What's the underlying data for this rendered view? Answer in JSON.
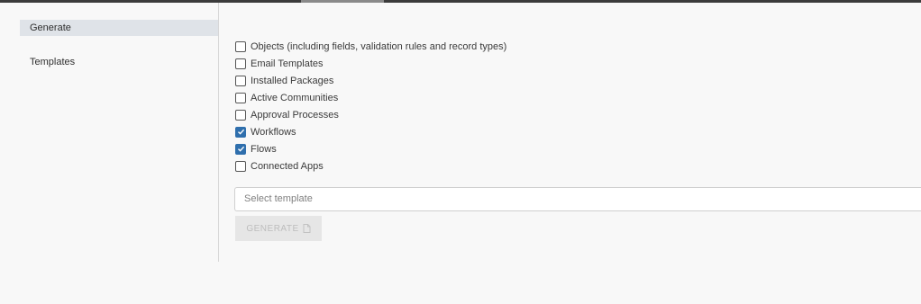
{
  "sidebar": {
    "items": [
      {
        "label": "Generate",
        "active": true
      },
      {
        "label": "Templates",
        "active": false
      }
    ]
  },
  "options": [
    {
      "label": "Objects (including fields, validation rules and record types)",
      "checked": false
    },
    {
      "label": "Email Templates",
      "checked": false
    },
    {
      "label": "Installed Packages",
      "checked": false
    },
    {
      "label": "Active Communities",
      "checked": false
    },
    {
      "label": "Approval Processes",
      "checked": false
    },
    {
      "label": "Workflows",
      "checked": true
    },
    {
      "label": "Flows",
      "checked": true
    },
    {
      "label": "Connected Apps",
      "checked": false
    }
  ],
  "template_select": {
    "placeholder": "Select template"
  },
  "generate_button": {
    "label": "GENERATE",
    "icon": "document-icon",
    "disabled": true
  },
  "colors": {
    "checkbox_checked": "#2f6fad",
    "active_nav": "#dfe3e8"
  }
}
